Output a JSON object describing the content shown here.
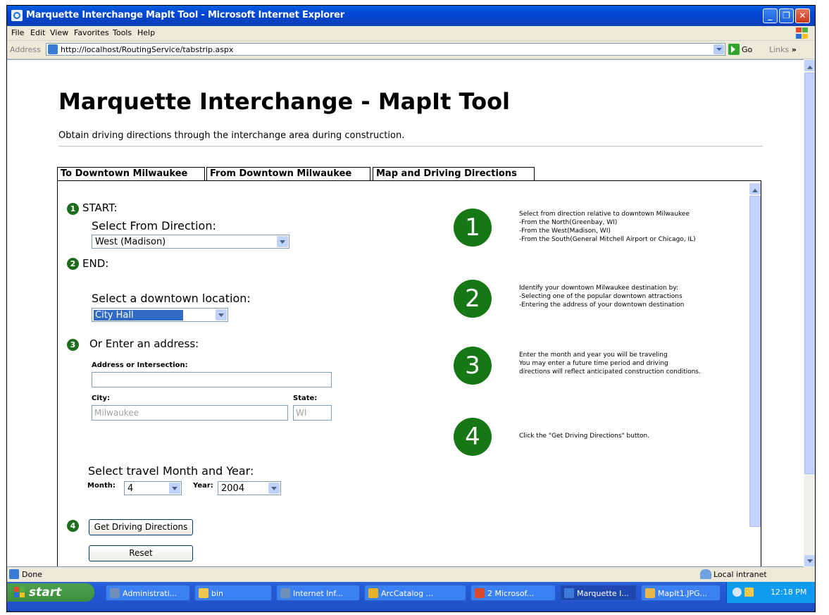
{
  "window": {
    "title": "Marquette Interchange MapIt Tool - Microsoft Internet Explorer",
    "min_symbol": "_",
    "max_symbol": "❐",
    "close_symbol": "✕"
  },
  "menu": [
    "File",
    "Edit",
    "View",
    "Favorites",
    "Tools",
    "Help"
  ],
  "address": {
    "label": "Address",
    "url": "http://localhost/RoutingService/tabstrip.aspx",
    "go": "Go",
    "links": "Links",
    "links_chevron": "»"
  },
  "page": {
    "title": "Marquette Interchange - MapIt Tool",
    "subtitle": "Obtain driving directions through the interchange area during construction."
  },
  "tabs": [
    "To Downtown Milwaukee",
    "From Downtown Milwaukee",
    "Map and Driving Directions"
  ],
  "form": {
    "step1_num": "1",
    "step1_label": "START:",
    "from_direction_label": "Select From Direction:",
    "from_direction_value": "West (Madison)",
    "step2_num": "2",
    "step2_label": "END:",
    "location_label": "Select a downtown location:",
    "location_value": "City Hall",
    "step3_num": "3",
    "step3_label": "Or Enter an address:",
    "address_label": "Address or Intersection:",
    "address_value": "",
    "city_label": "City:",
    "city_value": "Milwaukee",
    "state_label": "State:",
    "state_value": "WI",
    "month_year_label": "Select travel Month and Year:",
    "month_label": "Month:",
    "month_value": "4",
    "year_label": "Year:",
    "year_value": "2004",
    "step4_num": "4",
    "get_directions_label": "Get Driving Directions",
    "reset_label": "Reset"
  },
  "instructions": [
    {
      "num": "1",
      "lines": [
        "Select from direction relative to downtown Milwaukee",
        "-From the North(Greenbay, WI)",
        "-From the West(Madison, WI)",
        "-From the South(General Mitchell Airport or Chicago, IL)"
      ]
    },
    {
      "num": "2",
      "lines": [
        "Identify your downtown Milwaukee destination by:",
        "-Selecting one of the popular downtown attractions",
        "-Entering the address of your downtown destination"
      ]
    },
    {
      "num": "3",
      "lines": [
        "Enter the month and year you will be traveling",
        "You may enter a future time period and driving",
        "directions will reflect anticipated construction conditions."
      ]
    },
    {
      "num": "4",
      "lines": [
        "Click the \"Get Driving Directions\" button."
      ]
    }
  ],
  "status": {
    "text": "Done",
    "zone": "Local intranet"
  },
  "taskbar": {
    "start": "start",
    "buttons": [
      {
        "label": "Administrati...",
        "color": "#6f8fb8"
      },
      {
        "label": "bin",
        "color": "#f0c850"
      },
      {
        "label": "Internet Inf...",
        "color": "#6f8fb8"
      },
      {
        "label": "ArcCatalog ...",
        "color": "#e6b22a"
      },
      {
        "label": "2 Microsof...",
        "color": "#d84a2a"
      },
      {
        "label": "Marquette I...",
        "color": "#3a7bd5"
      },
      {
        "label": "MapIt1.JPG...",
        "color": "#e8b84a"
      }
    ],
    "clock": "12:18 PM"
  }
}
